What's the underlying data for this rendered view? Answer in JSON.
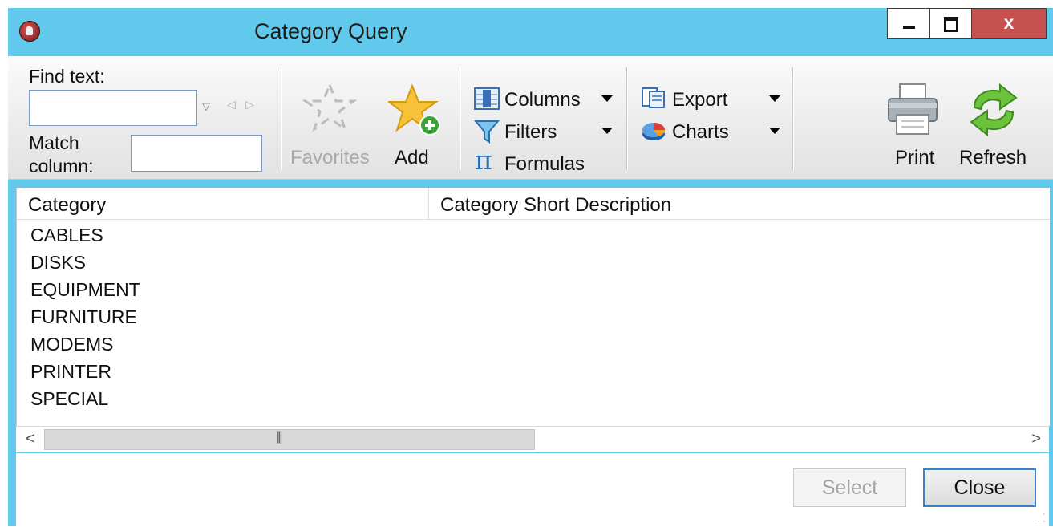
{
  "window": {
    "title": "Category Query",
    "controls": {
      "minimize": "minimize",
      "maximize": "maximize",
      "close": "x"
    }
  },
  "toolbar": {
    "find_text_label": "Find text:",
    "find_text_value": "",
    "match_column_label_line1": "Match",
    "match_column_label_line2": "column:",
    "match_column_value": "",
    "favorites_label": "Favorites",
    "add_label": "Add",
    "columns_label": "Columns",
    "filters_label": "Filters",
    "formulas_label": "Formulas",
    "export_label": "Export",
    "charts_label": "Charts",
    "print_label": "Print",
    "refresh_label": "Refresh"
  },
  "grid": {
    "columns": [
      "Category",
      "Category Short Description"
    ],
    "rows": [
      "CABLES",
      "DISKS",
      "EQUIPMENT",
      "FURNITURE",
      "MODEMS",
      "PRINTER",
      "SPECIAL"
    ]
  },
  "footer": {
    "select_label": "Select",
    "close_label": "Close"
  },
  "icons": [
    "app-icon",
    "favorites-icon",
    "add-star-icon",
    "columns-icon",
    "filters-icon",
    "formulas-icon",
    "export-icon",
    "charts-icon",
    "print-icon",
    "refresh-icon"
  ],
  "colors": {
    "titlebar": "#61c9ec",
    "close_button": "#c75050",
    "focus_border": "#3c82c8"
  }
}
